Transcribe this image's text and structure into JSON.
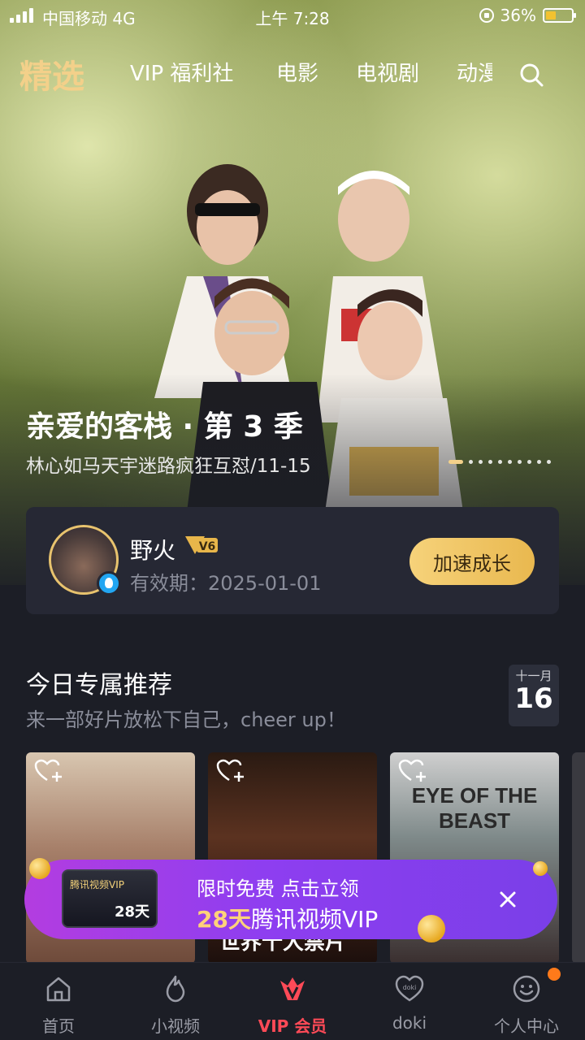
{
  "status_bar": {
    "carrier": "中国移动  4G",
    "time": "上午 7:28",
    "battery_percent": "36%"
  },
  "top_nav": {
    "tabs": [
      {
        "label": "精选",
        "active": true
      },
      {
        "label": "VIP 福利社",
        "active": false
      },
      {
        "label": "电影",
        "active": false
      },
      {
        "label": "电视剧",
        "active": false
      },
      {
        "label": "动漫",
        "active": false
      }
    ]
  },
  "hero": {
    "title": "亲爱的客栈 · 第 3 季",
    "subtitle": "林心如马天宇迷路疯狂互怼/11-15"
  },
  "user_card": {
    "name": "野火",
    "vip_level": "V6",
    "validity": "有效期：2025-01-01",
    "button": "加速成长"
  },
  "section": {
    "title": "今日专属推荐",
    "subtitle": "来一部好片放松下自己，cheer up！",
    "calendar_month": "十一月",
    "calendar_day": "16"
  },
  "posters": {
    "p2_title": "世界十大禁片",
    "p3_title": "EYE OF THE BEAST"
  },
  "promo": {
    "card_brand": "腾讯视频VIP",
    "card_days": "28天",
    "line1": "限时免费  点击立领",
    "line2_highlight": "28天",
    "line2_rest": "腾讯视频VIP"
  },
  "bottom_nav": [
    {
      "label": "首页",
      "icon": "home-icon"
    },
    {
      "label": "小视频",
      "icon": "flame-icon"
    },
    {
      "label": "VIP 会员",
      "icon": "vip-crown-icon",
      "active": true
    },
    {
      "label": "doki",
      "icon": "doki-heart-icon"
    },
    {
      "label": "个人中心",
      "icon": "smile-icon"
    }
  ],
  "colors": {
    "accent_gold": "#f3d08a",
    "vip_red": "#ff4a57",
    "promo_purple": "#8e3ef0"
  }
}
